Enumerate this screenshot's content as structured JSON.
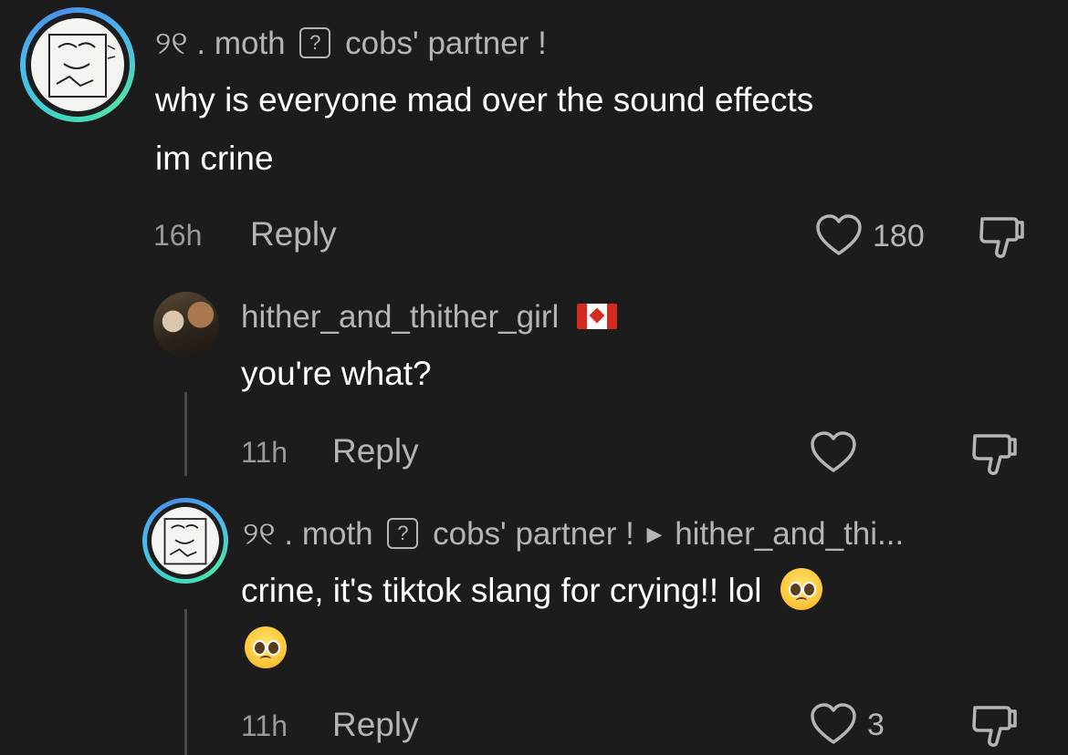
{
  "comments": [
    {
      "username": "୨୧ . moth",
      "badge_icon": "question-box",
      "badge_text": "cobs' partner !",
      "text_lines": [
        "why is everyone mad over the sound effects",
        "im crine"
      ],
      "time": "16h",
      "reply_label": "Reply",
      "likes": "180"
    },
    {
      "username": "hither_and_thither_girl",
      "flag": "canada-flag",
      "text_lines": [
        "you're what?"
      ],
      "time": "11h",
      "reply_label": "Reply",
      "likes": ""
    },
    {
      "username": "୨୧ . moth",
      "badge_icon": "question-box",
      "badge_text": "cobs' partner !",
      "reply_to": "hither_and_thi...",
      "text_lines": [
        "crine, it's tiktok slang for crying!! lol"
      ],
      "emoji": "pleading-face",
      "time": "11h",
      "reply_label": "Reply",
      "likes": "3"
    }
  ],
  "colors": {
    "background": "#1c1c1c",
    "text": "#ffffff",
    "muted": "#b5b5b5",
    "ring": "#49b8f0"
  }
}
